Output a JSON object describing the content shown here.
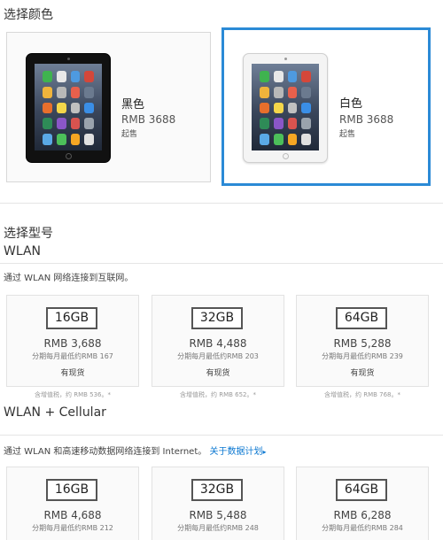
{
  "color_section": {
    "title": "选择颜色",
    "options": [
      {
        "name": "黑色",
        "price": "RMB 3688",
        "suffix": "起售",
        "selected": false
      },
      {
        "name": "白色",
        "price": "RMB 3688",
        "suffix": "起售",
        "selected": true
      }
    ]
  },
  "model_section": {
    "title": "选择型号",
    "wlan": {
      "title": "WLAN",
      "description": "通过 WLAN 网络连接到互联网。",
      "models": [
        {
          "capacity": "16GB",
          "price": "RMB 3,688",
          "installment": "分期每月最低约RMB 167",
          "stock": "有现货",
          "vat": "含增值税，约 RMB 536。*"
        },
        {
          "capacity": "32GB",
          "price": "RMB 4,488",
          "installment": "分期每月最低约RMB 203",
          "stock": "有现货",
          "vat": "含增值税，约 RMB 652。*"
        },
        {
          "capacity": "64GB",
          "price": "RMB 5,288",
          "installment": "分期每月最低约RMB 239",
          "stock": "有现货",
          "vat": "含增值税，约 RMB 768。*"
        }
      ]
    },
    "cellular": {
      "title": "WLAN + Cellular",
      "description": "通过 WLAN 和高速移动数据网络连接到 Internet。",
      "link": "关于数据计划",
      "link_arrow": "▸",
      "models": [
        {
          "capacity": "16GB",
          "price": "RMB 4,688",
          "installment": "分期每月最低约RMB 212"
        },
        {
          "capacity": "32GB",
          "price": "RMB 5,488",
          "installment": "分期每月最低约RMB 248"
        },
        {
          "capacity": "64GB",
          "price": "RMB 6,288",
          "installment": "分期每月最低约RMB 284"
        }
      ]
    }
  },
  "colors": {
    "selected_border": "#2b8ad6",
    "link": "#0a77d1",
    "card_border": "#e2e2e2"
  }
}
